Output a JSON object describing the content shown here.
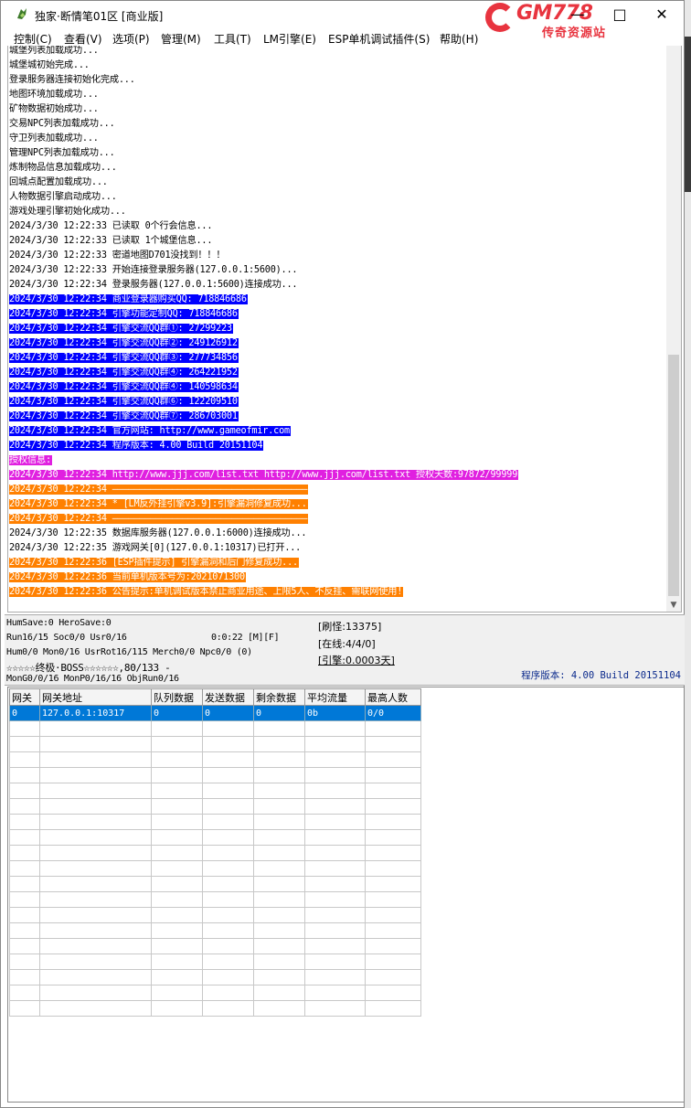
{
  "title": "独家·断情笔01区 [商业版]",
  "window_controls": {
    "minimize": "—",
    "maximize": "□",
    "close": "✕"
  },
  "logo": {
    "brand": "GM778",
    "subtitle": "传奇资源站"
  },
  "menu": [
    "控制(C)",
    "查看(V)",
    "选项(P)",
    "管理(M)",
    "工具(T)",
    "LM引擎(E)",
    "ESP单机调试插件(S)",
    "帮助(H)"
  ],
  "log": [
    {
      "text": "城堡列表加载成功...",
      "style": ""
    },
    {
      "text": "城堡城初始完成...",
      "style": ""
    },
    {
      "text": "登录服务器连接初始化完成...",
      "style": ""
    },
    {
      "text": "地图环境加载成功...",
      "style": ""
    },
    {
      "text": "矿物数据初始成功...",
      "style": ""
    },
    {
      "text": "交易NPC列表加载成功...",
      "style": ""
    },
    {
      "text": "守卫列表加载成功...",
      "style": ""
    },
    {
      "text": "管理NPC列表加载成功...",
      "style": ""
    },
    {
      "text": "炼制物品信息加载成功...",
      "style": ""
    },
    {
      "text": "回城点配置加载成功...",
      "style": ""
    },
    {
      "text": "人物数据引擎启动成功...",
      "style": ""
    },
    {
      "text": "游戏处理引擎初始化成功...",
      "style": ""
    },
    {
      "text": "2024/3/30 12:22:33 已读取 0个行会信息...",
      "style": ""
    },
    {
      "text": "2024/3/30 12:22:33 已读取 1个城堡信息...",
      "style": ""
    },
    {
      "text": "2024/3/30 12:22:33 密道地图D701没找到！！！",
      "style": ""
    },
    {
      "text": "2024/3/30 12:22:33 开始连接登录服务器(127.0.0.1:5600)...",
      "style": ""
    },
    {
      "text": "2024/3/30 12:22:34 登录服务器(127.0.0.1:5600)连接成功...",
      "style": ""
    },
    {
      "text": "2024/3/30 12:22:34 商业登录器购买QQ: 718846686",
      "style": "blue"
    },
    {
      "text": "2024/3/30 12:22:34 引擎功能定制QQ: 718846686",
      "style": "blue"
    },
    {
      "text": "2024/3/30 12:22:34 引擎交流QQ群①: 27299223",
      "style": "blue"
    },
    {
      "text": "2024/3/30 12:22:34 引擎交流QQ群②: 249126912",
      "style": "blue"
    },
    {
      "text": "2024/3/30 12:22:34 引擎交流QQ群③: 277734856",
      "style": "blue"
    },
    {
      "text": "2024/3/30 12:22:34 引擎交流QQ群④: 264221952",
      "style": "blue"
    },
    {
      "text": "2024/3/30 12:22:34 引擎交流QQ群④: 140598634",
      "style": "blue"
    },
    {
      "text": "2024/3/30 12:22:34 引擎交流QQ群⑥: 122209510",
      "style": "blue"
    },
    {
      "text": "2024/3/30 12:22:34 引擎交流QQ群⑦: 286703001",
      "style": "blue"
    },
    {
      "text": "2024/3/30 12:22:34 官方网站: http://www.gameofmir.com",
      "style": "blue"
    },
    {
      "text": "2024/3/30 12:22:34 程序版本: 4.00 Build 20151104",
      "style": "blue"
    },
    {
      "text": "授权信息:",
      "style": "magenta"
    },
    {
      "text": "2024/3/30 12:22:34 http://www.jjj.com/list.txt http://www.jjj.com/list.txt 授权天数:97872/99999",
      "style": "magenta"
    },
    {
      "text": "2024/3/30 12:22:34 ————————————————————————————————————",
      "style": "orange"
    },
    {
      "text": "2024/3/30 12:22:34 * [LM反外挂引擎v3.9]:引擎漏洞修复成功...",
      "style": "orange"
    },
    {
      "text": "2024/3/30 12:22:34 ————————————————————————————————————",
      "style": "orange"
    },
    {
      "text": "2024/3/30 12:22:35 数据库服务器(127.0.0.1:6000)连接成功...",
      "style": ""
    },
    {
      "text": "2024/3/30 12:22:35 游戏网关[0](127.0.0.1:10317)已打开...",
      "style": ""
    },
    {
      "text": "2024/3/30 12:22:36 [ESP插件提示] 引擎漏洞和后门修复成功...",
      "style": "orange"
    },
    {
      "text": "2024/3/30 12:22:36 当前单机版本号为:2021071300",
      "style": "orange"
    },
    {
      "text": "2024/3/30 12:22:36 公告提示:单机调试版本禁止商业用途、上限5人、不反挂、需联网使用!",
      "style": "orange"
    }
  ],
  "status": {
    "line1": "HumSave:0 HeroSave:0",
    "line2a": "Run16/15 Soc0/0 Usr0/16",
    "line2b": "0:0:22 [M][F]",
    "line3": "Hum0/0 Mon0/16 UsrRot16/115 Merch0/0 Npc0/0 (0)",
    "line4": "☆☆☆☆☆终极·BOSS☆☆☆☆☆☆,80/133 -",
    "line5": "MonG0/0/16 MonP0/16/16 ObjRun0/16",
    "refresh": "[刷怪:13375]",
    "online": "[在线:4/4/0]",
    "engine": "[引擎:0.0003天]",
    "version": "程序版本: 4.00 Build 20151104"
  },
  "gateway_table": {
    "headers": [
      "网关",
      "网关地址",
      "队列数据",
      "发送数据",
      "剩余数据",
      "平均流量",
      "最高人数"
    ],
    "rows": [
      [
        "0",
        "127.0.0.1:10317",
        "0",
        "0",
        "0",
        "0b",
        "0/0"
      ]
    ]
  }
}
